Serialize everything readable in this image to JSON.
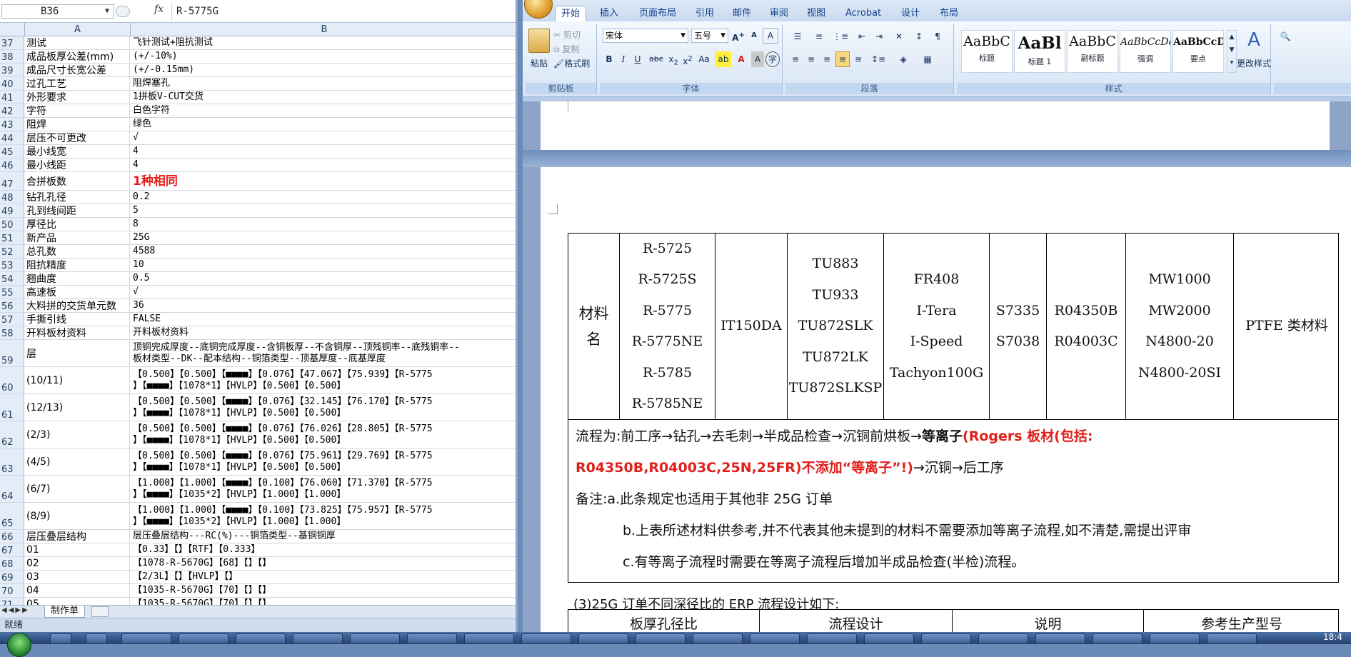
{
  "excel": {
    "name_box": "B36",
    "formula_value": "R-5775G",
    "columns": [
      "A",
      "B"
    ],
    "rows": [
      {
        "n": "37",
        "a": "测试",
        "b": "飞针测试+阻抗测试"
      },
      {
        "n": "38",
        "a": "成品板厚公差(mm)",
        "b": "(+/-10%)"
      },
      {
        "n": "39",
        "a": "成品尺寸长宽公差",
        "b": "(+/-0.15mm)"
      },
      {
        "n": "40",
        "a": "过孔工艺",
        "b": "阻焊塞孔"
      },
      {
        "n": "41",
        "a": "外形要求",
        "b": "1拼板V-CUT交货"
      },
      {
        "n": "42",
        "a": "字符",
        "b": "白色字符"
      },
      {
        "n": "43",
        "a": "阻焊",
        "b": "绿色"
      },
      {
        "n": "44",
        "a": "层压不可更改",
        "b": "√"
      },
      {
        "n": "45",
        "a": "最小线宽",
        "b": "4"
      },
      {
        "n": "46",
        "a": "最小线距",
        "b": "4"
      },
      {
        "n": "47",
        "a": "合拼板数",
        "b": "1种相同"
      },
      {
        "n": "48",
        "a": "钻孔孔径",
        "b": "0.2"
      },
      {
        "n": "49",
        "a": "孔到线间距",
        "b": "5"
      },
      {
        "n": "50",
        "a": "厚径比",
        "b": "8"
      },
      {
        "n": "51",
        "a": "新产品",
        "b": "25G"
      },
      {
        "n": "52",
        "a": "总孔数",
        "b": "4588"
      },
      {
        "n": "53",
        "a": "阻抗精度",
        "b": "10"
      },
      {
        "n": "54",
        "a": "翘曲度",
        "b": "0.5"
      },
      {
        "n": "55",
        "a": "高速板",
        "b": "√"
      },
      {
        "n": "56",
        "a": "大料拼的交货单元数",
        "b": "36"
      },
      {
        "n": "57",
        "a": "手撕引线",
        "b": "FALSE"
      },
      {
        "n": "58",
        "a": "开料板材资料",
        "b": "开料板材资料"
      },
      {
        "n": "59",
        "a": "层",
        "b": "顶铜完成厚度--底铜完成厚度--含铜板厚--不含铜厚--顶残铜率--底残铜率--\n板材类型--DK--配本结构--铜箔类型--顶基厚度--底基厚度"
      },
      {
        "n": "60",
        "a": "(10/11)",
        "b": "【0.500】【0.500】【■■■■】【0.076】【47.067】【75.939】【R-5775\n】【■■■■】【1078*1】【HVLP】【0.500】【0.500】"
      },
      {
        "n": "61",
        "a": "(12/13)",
        "b": "【0.500】【0.500】【■■■■】【0.076】【32.145】【76.170】【R-5775\n】【■■■■】【1078*1】【HVLP】【0.500】【0.500】"
      },
      {
        "n": "62",
        "a": "(2/3)",
        "b": "【0.500】【0.500】【■■■■】【0.076】【76.026】【28.805】【R-5775\n】【■■■■】【1078*1】【HVLP】【0.500】【0.500】"
      },
      {
        "n": "63",
        "a": "(4/5)",
        "b": "【0.500】【0.500】【■■■■】【0.076】【75.961】【29.769】【R-5775\n】【■■■■】【1078*1】【HVLP】【0.500】【0.500】"
      },
      {
        "n": "64",
        "a": "(6/7)",
        "b": "【1.000】【1.000】【■■■■】【0.100】【76.060】【71.370】【R-5775\n】【■■■■】【1035*2】【HVLP】【1.000】【1.000】"
      },
      {
        "n": "65",
        "a": "(8/9)",
        "b": "【1.000】【1.000】【■■■■】【0.100】【73.825】【75.957】【R-5775\n】【■■■■】【1035*2】【HVLP】【1.000】【1.000】"
      },
      {
        "n": "66",
        "a": "层压叠层结构",
        "b": "层压叠层结构---RC(%)---铜箔类型--基铜铜厚"
      },
      {
        "n": "67",
        "a": "01",
        "b": "【0.33】【】【RTF】【0.333】"
      },
      {
        "n": "68",
        "a": "02",
        "b": "【1078-R-5670G】【68】【】【】"
      },
      {
        "n": "69",
        "a": "03",
        "b": "【2/3L】【】【HVLP】【】"
      },
      {
        "n": "70",
        "a": "04",
        "b": "【1035-R-5670G】【70】【】【】"
      },
      {
        "n": "71",
        "a": "05",
        "b": "【1035-R-5670G】【70】【】【】"
      }
    ],
    "sheet_tab": "制作单",
    "status": "就绪"
  },
  "word": {
    "tabs": [
      "开始",
      "插入",
      "页面布局",
      "引用",
      "邮件",
      "审阅",
      "视图",
      "Acrobat",
      "设计",
      "布局"
    ],
    "active_tab": "开始",
    "clipboard": {
      "paste": "粘贴",
      "cut": "剪切",
      "copy": "复制",
      "format_painter": "格式刷",
      "label": "剪贴板"
    },
    "font": {
      "name": "宋体",
      "size": "五号",
      "label": "字体"
    },
    "paragraph_label": "段落",
    "styles": [
      {
        "preview": "AaBbC",
        "name": "标题"
      },
      {
        "preview": "AaBl",
        "name": "标题 1"
      },
      {
        "preview": "AaBbC",
        "name": "副标题"
      },
      {
        "preview": "AaBbCcDc",
        "name": "强调"
      },
      {
        "preview": "AaBbCcD",
        "name": "要点"
      }
    ],
    "change_styles": "更改样式",
    "styles_label": "样式",
    "material_table": {
      "header": "材料\n名",
      "groups": [
        [
          "R-5725",
          "R-5725S",
          "R-5775",
          "R-5775NE",
          "R-5785",
          "R-5785NE"
        ],
        [
          "IT150DA"
        ],
        [
          "TU883",
          "TU933",
          "TU872SLK",
          "TU872LK",
          "TU872SLKSP"
        ],
        [
          "FR408",
          "I-Tera",
          "I-Speed",
          "Tachyon100G"
        ],
        [
          "S7335",
          "S7038"
        ],
        [
          "R04350B",
          "R04003C"
        ],
        [
          "MW1000",
          "MW2000",
          "N4800-20",
          "N4800-20SI"
        ],
        [
          "PTFE 类材料"
        ]
      ]
    },
    "flow": {
      "line1_a": "流程为:前工序→钻孔→去毛刺→半成品检查→沉铜前烘板→",
      "line1_b": "等离子",
      "line1_c": "(Rogers 板材(包括:",
      "line2_a": "R04350B,R04003C,25N,25FR)不添加“等离子”!)",
      "line2_b": "→沉铜→后工序"
    },
    "notes": {
      "a": "备注:a.此条规定也适用于其他非 25G 订单",
      "b": "b.上表所述材料供参考,并不代表其他未提到的材料不需要添加等离子流程,如不清楚,需提出评审",
      "c": "c.有等离子流程时需要在等离子流程后增加半成品检查(半检)流程。"
    },
    "section3": "(3)25G 订单不同深径比的 ERP 流程设计如下:",
    "table2_headers": [
      "板厚孔径比",
      "流程设计",
      "说明",
      "参考生产型号"
    ]
  },
  "taskbar": {
    "clock": "18:4"
  }
}
